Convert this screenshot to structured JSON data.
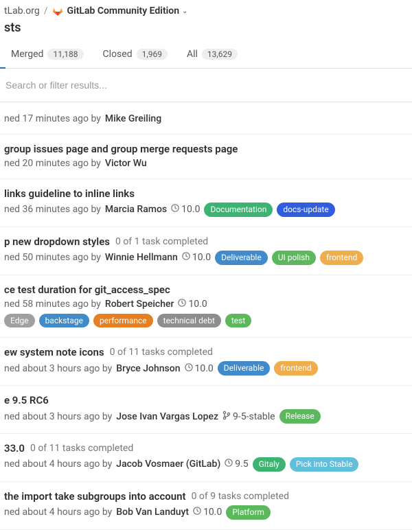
{
  "breadcrumbs": {
    "group": "tLab.org",
    "project": "GitLab Community Edition"
  },
  "page_title": "sts",
  "tabs": {
    "merged": {
      "label": "Merged",
      "count": "11,188"
    },
    "closed": {
      "label": "Closed",
      "count": "1,969"
    },
    "all": {
      "label": "All",
      "count": "13,629"
    }
  },
  "search_placeholder": "Search or filter results...",
  "label_colors": {
    "Documentation": "#3cb371",
    "docs-update": "#305cde",
    "Deliverable": "#428bca",
    "UI polish": "#5cb85c",
    "frontend": "#f0ad4e",
    "Edge": "#a0a0a0",
    "backstage": "#428bca",
    "performance": "#e67e22",
    "technical debt": "#8e8e8e",
    "test": "#5cb85c",
    "Release": "#5cb85c",
    "Gitaly": "#3cb371",
    "Pick into Stable": "#60c0dc",
    "Platform": "#5cb85c"
  },
  "items": [
    {
      "title": "",
      "tasks": "",
      "time": "ned 17 minutes ago by",
      "author": "Mike Greiling",
      "milestone": "",
      "branch": "",
      "labels": []
    },
    {
      "title": "group issues page and group merge requests page",
      "tasks": "",
      "time": "ned 20 minutes ago by",
      "author": "Victor Wu",
      "milestone": "",
      "branch": "",
      "labels": []
    },
    {
      "title": "links guideline to inline links",
      "tasks": "",
      "time": "ned 36 minutes ago by",
      "author": "Marcia Ramos",
      "milestone": "10.0",
      "branch": "",
      "labels": [
        "Documentation",
        "docs-update"
      ]
    },
    {
      "title": "p new dropdown styles",
      "tasks": "0 of 1 task completed",
      "time": "ned 50 minutes ago by",
      "author": "Winnie Hellmann",
      "milestone": "10.0",
      "branch": "",
      "labels": [
        "Deliverable",
        "UI polish",
        "frontend"
      ]
    },
    {
      "title": "ce test duration for git_access_spec",
      "tasks": "",
      "time": "ned 58 minutes ago by",
      "author": "Robert Speicher",
      "milestone": "10.0",
      "branch": "",
      "labels": [
        "Edge",
        "backstage",
        "performance",
        "technical debt",
        "test"
      ]
    },
    {
      "title": "ew system note icons",
      "tasks": "0 of 11 tasks completed",
      "time": "ned about 3 hours ago by",
      "author": "Bryce Johnson",
      "milestone": "10.0",
      "branch": "",
      "labels": [
        "Deliverable",
        "frontend"
      ]
    },
    {
      "title": "e 9.5 RC6",
      "tasks": "",
      "time": "ned about 3 hours ago by",
      "author": "Jose Ivan Vargas Lopez",
      "milestone": "",
      "branch": "9-5-stable",
      "labels": [
        "Release"
      ]
    },
    {
      "title": "33.0",
      "tasks": "0 of 11 tasks completed",
      "time": "ned about 4 hours ago by",
      "author": "Jacob Vosmaer (GitLab)",
      "milestone": "9.5",
      "branch": "",
      "labels": [
        "Gitaly",
        "Pick into Stable"
      ]
    },
    {
      "title": "the import take subgroups into account",
      "tasks": "0 of 9 tasks completed",
      "time": "ned about 4 hours ago by",
      "author": "Bob Van Landuyt",
      "milestone": "10.0",
      "branch": "",
      "labels": [
        "Platform"
      ]
    }
  ]
}
